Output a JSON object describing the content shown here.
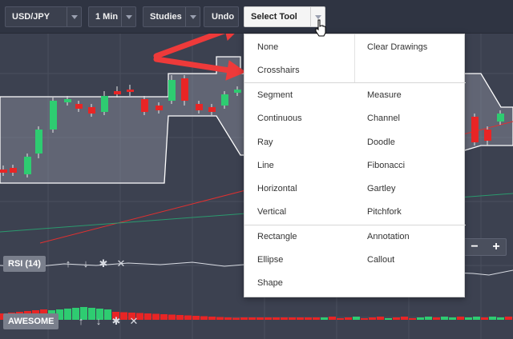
{
  "toolbar": {
    "symbol": "USD/JPY",
    "interval": "1 Min",
    "studies": "Studies",
    "undo": "Undo",
    "select_tool": "Select Tool"
  },
  "indicators": {
    "rsi": "RSI (14)",
    "awesome": "AWESOME"
  },
  "zoom": {
    "minus": "−",
    "plus": "+"
  },
  "menu": {
    "left": [
      "None",
      "Crosshairs",
      "Segment",
      "Continuous",
      "Ray",
      "Line",
      "Horizontal",
      "Vertical",
      "Rectangle",
      "Ellipse",
      "Shape"
    ],
    "right": [
      "Clear Drawings",
      "Measure",
      "Channel",
      "Doodle",
      "Fibonacci",
      "Gartley",
      "Pitchfork",
      "Annotation",
      "Callout"
    ]
  },
  "colors": {
    "up": "#2ecc71",
    "down": "#e82525",
    "arrow": "#ee3a3a"
  },
  "icons": {
    "up": "arrow-up-icon",
    "down": "arrow-down-icon",
    "settings": "gear-icon",
    "close": "close-icon"
  }
}
